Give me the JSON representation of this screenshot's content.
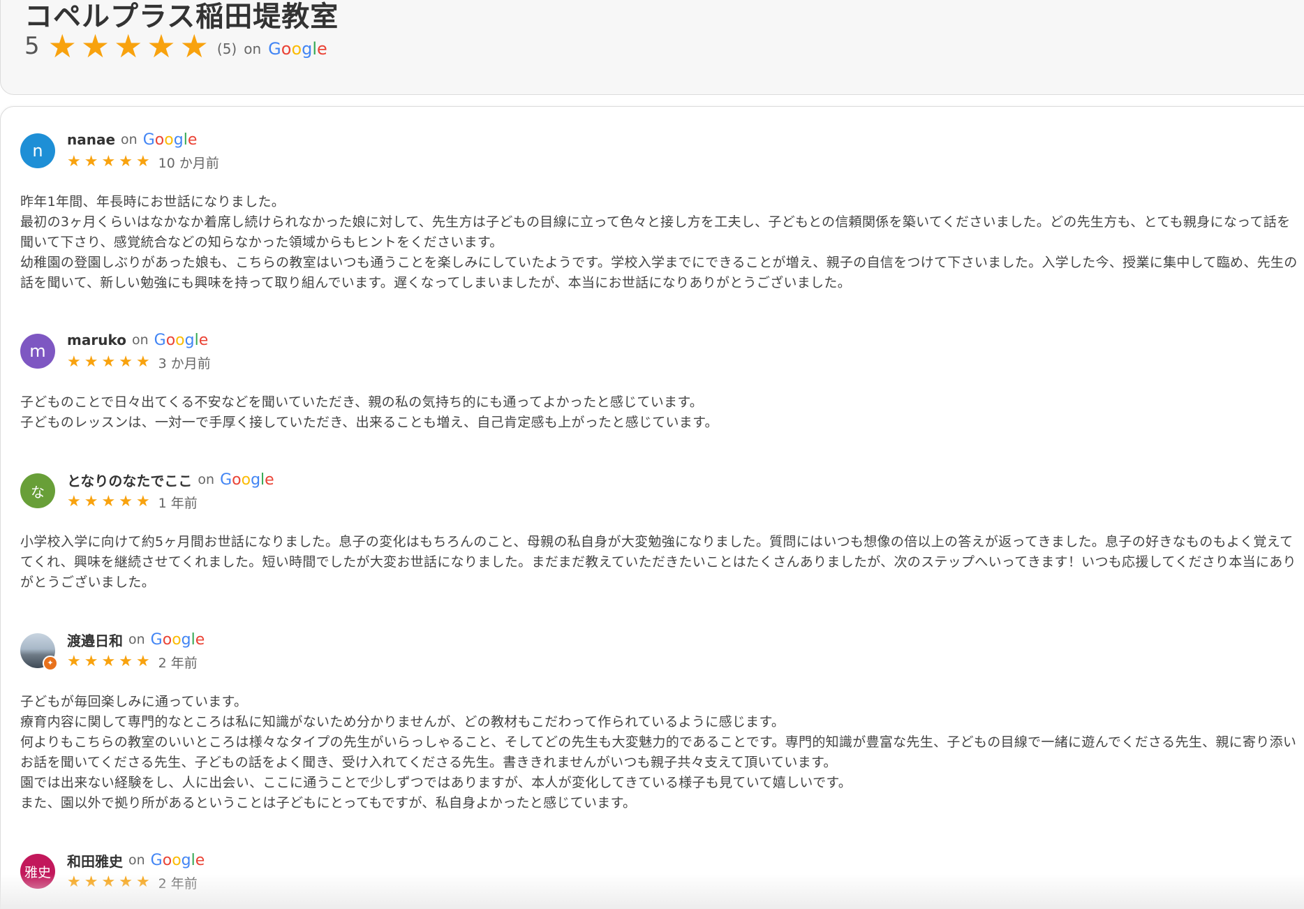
{
  "header": {
    "title": "コペルプラス稲田堤教室",
    "rating": "5",
    "review_count": "(5)",
    "on": "on",
    "star_count": 5
  },
  "google_logo": {
    "letters": [
      "G",
      "o",
      "o",
      "g",
      "l",
      "e"
    ],
    "colors": [
      "#4285F4",
      "#EA4335",
      "#FBBC05",
      "#4285F4",
      "#34A853",
      "#EA4335"
    ]
  },
  "colors": {
    "star": "#f8a20e"
  },
  "reviews": [
    {
      "initial": "n",
      "avatar_color": "#1e8fd6",
      "name": "nanae",
      "on": "on",
      "stars": 5,
      "time": "10 か月前",
      "text": "昨年1年間、年長時にお世話になりました。\n最初の3ヶ月くらいはなかなか着席し続けられなかった娘に対して、先生方は子どもの目線に立って色々と接し方を工夫し、子どもとの信頼関係を築いてくださいました。どの先生方も、とても親身になって話を聞いて下さり、感覚統合などの知らなかった領域からもヒントをくださいます。\n幼稚園の登園しぶりがあった娘も、こちらの教室はいつも通うことを楽しみにしていたようです。学校入学までにできることが増え、親子の自信をつけて下さいました。入学した今、授業に集中して臨め、先生の話を聞いて、新しい勉強にも興味を持って取り組んでいます。遅くなってしまいましたが、本当にお世話になりありがとうございました。"
    },
    {
      "initial": "m",
      "avatar_color": "#7e57c2",
      "name": "maruko",
      "on": "on",
      "stars": 5,
      "time": "3 か月前",
      "text": "子どものことで日々出てくる不安などを聞いていただき、親の私の気持ち的にも通ってよかったと感じています。\n子どものレッスンは、一対一で手厚く接していただき、出来ることも増え、自己肯定感も上がったと感じています。"
    },
    {
      "initial": "な",
      "avatar_color": "#689f38",
      "name": "となりのなたでここ",
      "on": "on",
      "stars": 5,
      "time": "1 年前",
      "text": "小学校入学に向けて約5ヶ月間お世話になりました。息子の変化はもちろんのこと、母親の私自身が大変勉強になりました。質問にはいつも想像の倍以上の答えが返ってきました。息子の好きなものもよく覚えててくれ、興味を継続させてくれました。短い時間でしたが大変お世話になりました。まだまだ教えていただきたいことはたくさんありましたが、次のステップへいってきます！いつも応援してくださり本当にありがとうございました。"
    },
    {
      "initial": "",
      "avatar_color": "",
      "name": "渡邉日和",
      "on": "on",
      "stars": 5,
      "time": "2 年前",
      "text": "子どもが毎回楽しみに通っています。\n療育内容に関して専門的なところは私に知識がないため分かりませんが、どの教材もこだわって作られているように感じます。\n何よりもこちらの教室のいいところは様々なタイプの先生がいらっしゃること、そしてどの先生も大変魅力的であることです。専門的知識が豊富な先生、子どもの目線で一緒に遊んでくださる先生、親に寄り添いお話を聞いてくださる先生、子どもの話をよく聞き、受け入れてくださる先生。書ききれませんがいつも親子共々支えて頂いています。\n園では出来ない経験をし、人に出会い、ここに通うことで少しずつではありますが、本人が変化してきている様子も見ていて嬉しいです。\nまた、園以外で拠り所があるということは子どもにとってもですが、私自身よかったと感じています。"
    },
    {
      "initial": "雅史",
      "avatar_color": "#c2185b",
      "name": "和田雅史",
      "on": "on",
      "stars": 5,
      "time": "2 年前",
      "text": ""
    }
  ]
}
